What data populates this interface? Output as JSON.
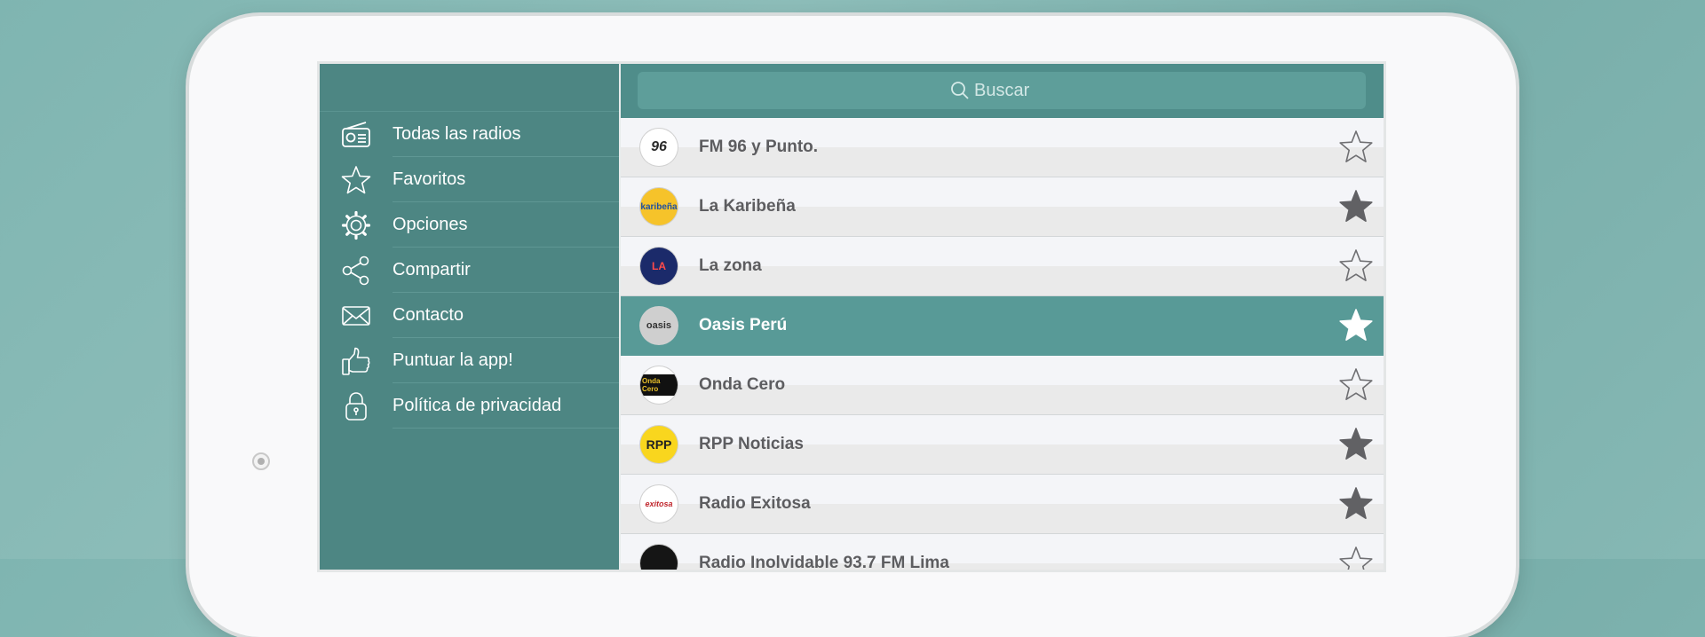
{
  "sidebar": {
    "items": [
      {
        "label": "Todas las radios",
        "icon": "radio-icon"
      },
      {
        "label": "Favoritos",
        "icon": "star-icon"
      },
      {
        "label": "Opciones",
        "icon": "gear-icon"
      },
      {
        "label": "Compartir",
        "icon": "share-icon"
      },
      {
        "label": "Contacto",
        "icon": "mail-icon"
      },
      {
        "label": "Puntuar la app!",
        "icon": "thumbs-up-icon"
      },
      {
        "label": "Política de privacidad",
        "icon": "lock-icon"
      }
    ]
  },
  "search": {
    "placeholder": "Buscar"
  },
  "stations": [
    {
      "name": "FM 96 y Punto.",
      "favorite": false,
      "logo_text": "96"
    },
    {
      "name": "La Karibeña",
      "favorite": true,
      "logo_text": "karibeña"
    },
    {
      "name": "La zona",
      "favorite": false,
      "logo_text": "LA"
    },
    {
      "name": "Oasis Perú",
      "favorite": false,
      "selected": true,
      "logo_text": "oasis"
    },
    {
      "name": "Onda Cero",
      "favorite": false,
      "logo_text": "Onda Cero"
    },
    {
      "name": "RPP Noticias",
      "favorite": true,
      "logo_text": "RPP"
    },
    {
      "name": "Radio Exitosa",
      "favorite": true,
      "logo_text": "exitosa"
    },
    {
      "name": "Radio Inolvidable 93.7 FM Lima",
      "favorite": false,
      "logo_text": ""
    }
  ],
  "colors": {
    "sidebar_bg": "#4d8683",
    "accent": "#589a97",
    "star_filled": "#616164",
    "star_outline": "#6f6f72"
  }
}
